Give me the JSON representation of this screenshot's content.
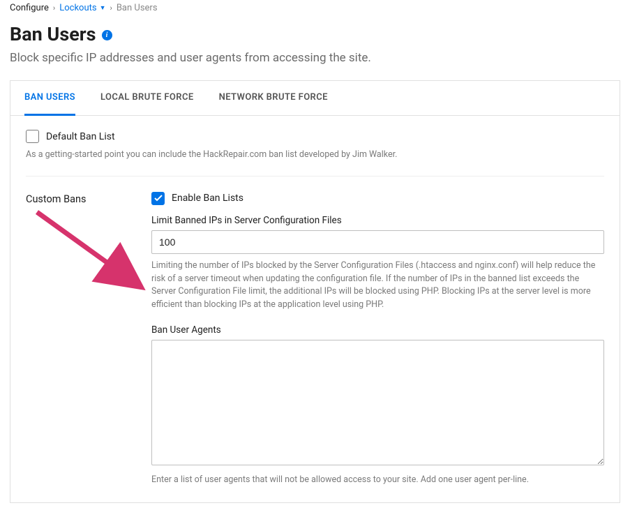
{
  "breadcrumb": {
    "root": "Configure",
    "parent": "Lockouts",
    "current": "Ban Users"
  },
  "page": {
    "title": "Ban Users",
    "subtitle": "Block specific IP addresses and user agents from accessing the site."
  },
  "tabs": [
    {
      "label": "BAN USERS",
      "active": true
    },
    {
      "label": "LOCAL BRUTE FORCE",
      "active": false
    },
    {
      "label": "NETWORK BRUTE FORCE",
      "active": false
    }
  ],
  "default_ban": {
    "checked": false,
    "label": "Default Ban List",
    "help": "As a getting-started point you can include the HackRepair.com ban list developed by Jim Walker."
  },
  "custom_bans": {
    "section_label": "Custom Bans",
    "enable": {
      "checked": true,
      "label": "Enable Ban Lists"
    },
    "limit": {
      "label": "Limit Banned IPs in Server Configuration Files",
      "value": "100",
      "help": "Limiting the number of IPs blocked by the Server Configuration Files (.htaccess and nginx.conf) will help reduce the risk of a server timeout when updating the configuration file. If the number of IPs in the banned list exceeds the Server Configuration File limit, the additional IPs will be blocked using PHP. Blocking IPs at the server level is more efficient than blocking IPs at the application level using PHP."
    },
    "user_agents": {
      "label": "Ban User Agents",
      "value": "",
      "help": "Enter a list of user agents that will not be allowed access to your site. Add one user agent per-line."
    }
  }
}
